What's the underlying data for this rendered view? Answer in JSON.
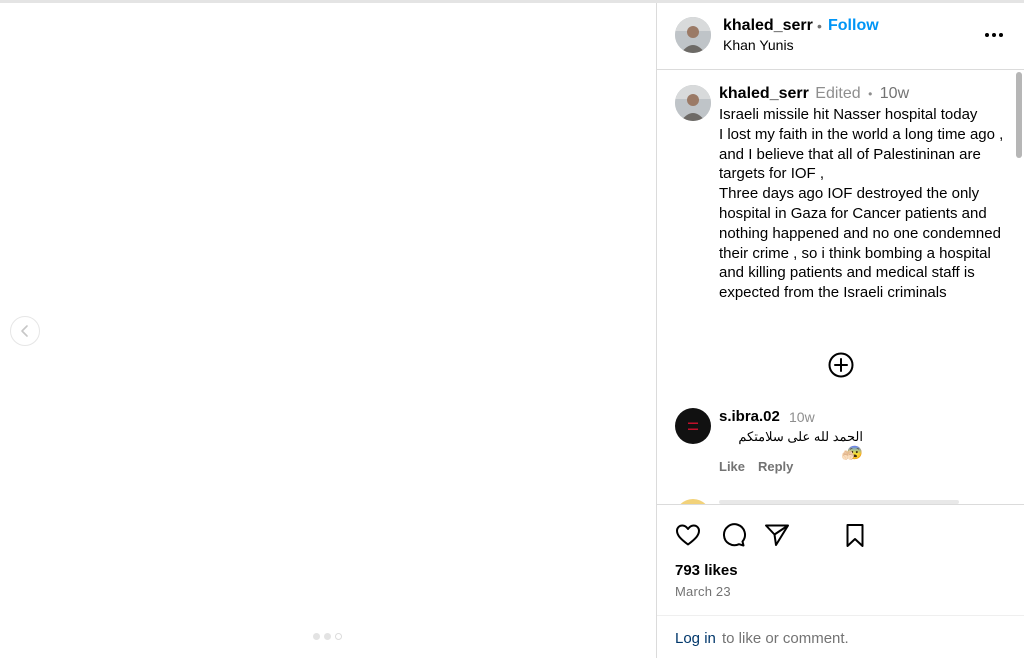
{
  "post": {
    "header": {
      "username": "khaled_serr",
      "separator": "•",
      "follow_label": "Follow",
      "location": "Khan Yunis",
      "more_icon": "more-options-icon"
    },
    "caption": {
      "username": "khaled_serr",
      "edited_label": "Edited",
      "separator": "•",
      "time_ago": "10w",
      "text": "Israeli missile hit Nasser hospital today\nI lost my faith in the world a long time ago , and I believe that all of Palestininan are targets for IOF ,\nThree days ago IOF destroyed the only hospital in Gaza for Cancer patients and nothing happened and no one condemned their crime , so i think bombing a hospital and killing patients and medical staff is expected from the Israeli criminals"
    },
    "load_more_icon": "plus-circle-icon",
    "comments": [
      {
        "username": "s.ibra.02",
        "time_ago": "10w",
        "text": "الحمد لله على سلامتكم 😨",
        "emoji_line": "🤲🏻",
        "like_label": "Like",
        "reply_label": "Reply"
      }
    ],
    "actions": {
      "like_icon": "heart-icon",
      "comment_icon": "comment-icon",
      "share_icon": "send-icon",
      "save_icon": "bookmark-icon"
    },
    "likes_text": "793 likes",
    "date_text": "March 23",
    "login": {
      "link_label": "Log in",
      "rest_text": " to like or comment."
    }
  },
  "media": {
    "prev_icon": "chevron-left-icon",
    "carousel_dots": 3
  },
  "colors": {
    "follow": "#0095f6",
    "link": "#00376b",
    "muted": "#737373",
    "border": "#dbdbdb"
  }
}
